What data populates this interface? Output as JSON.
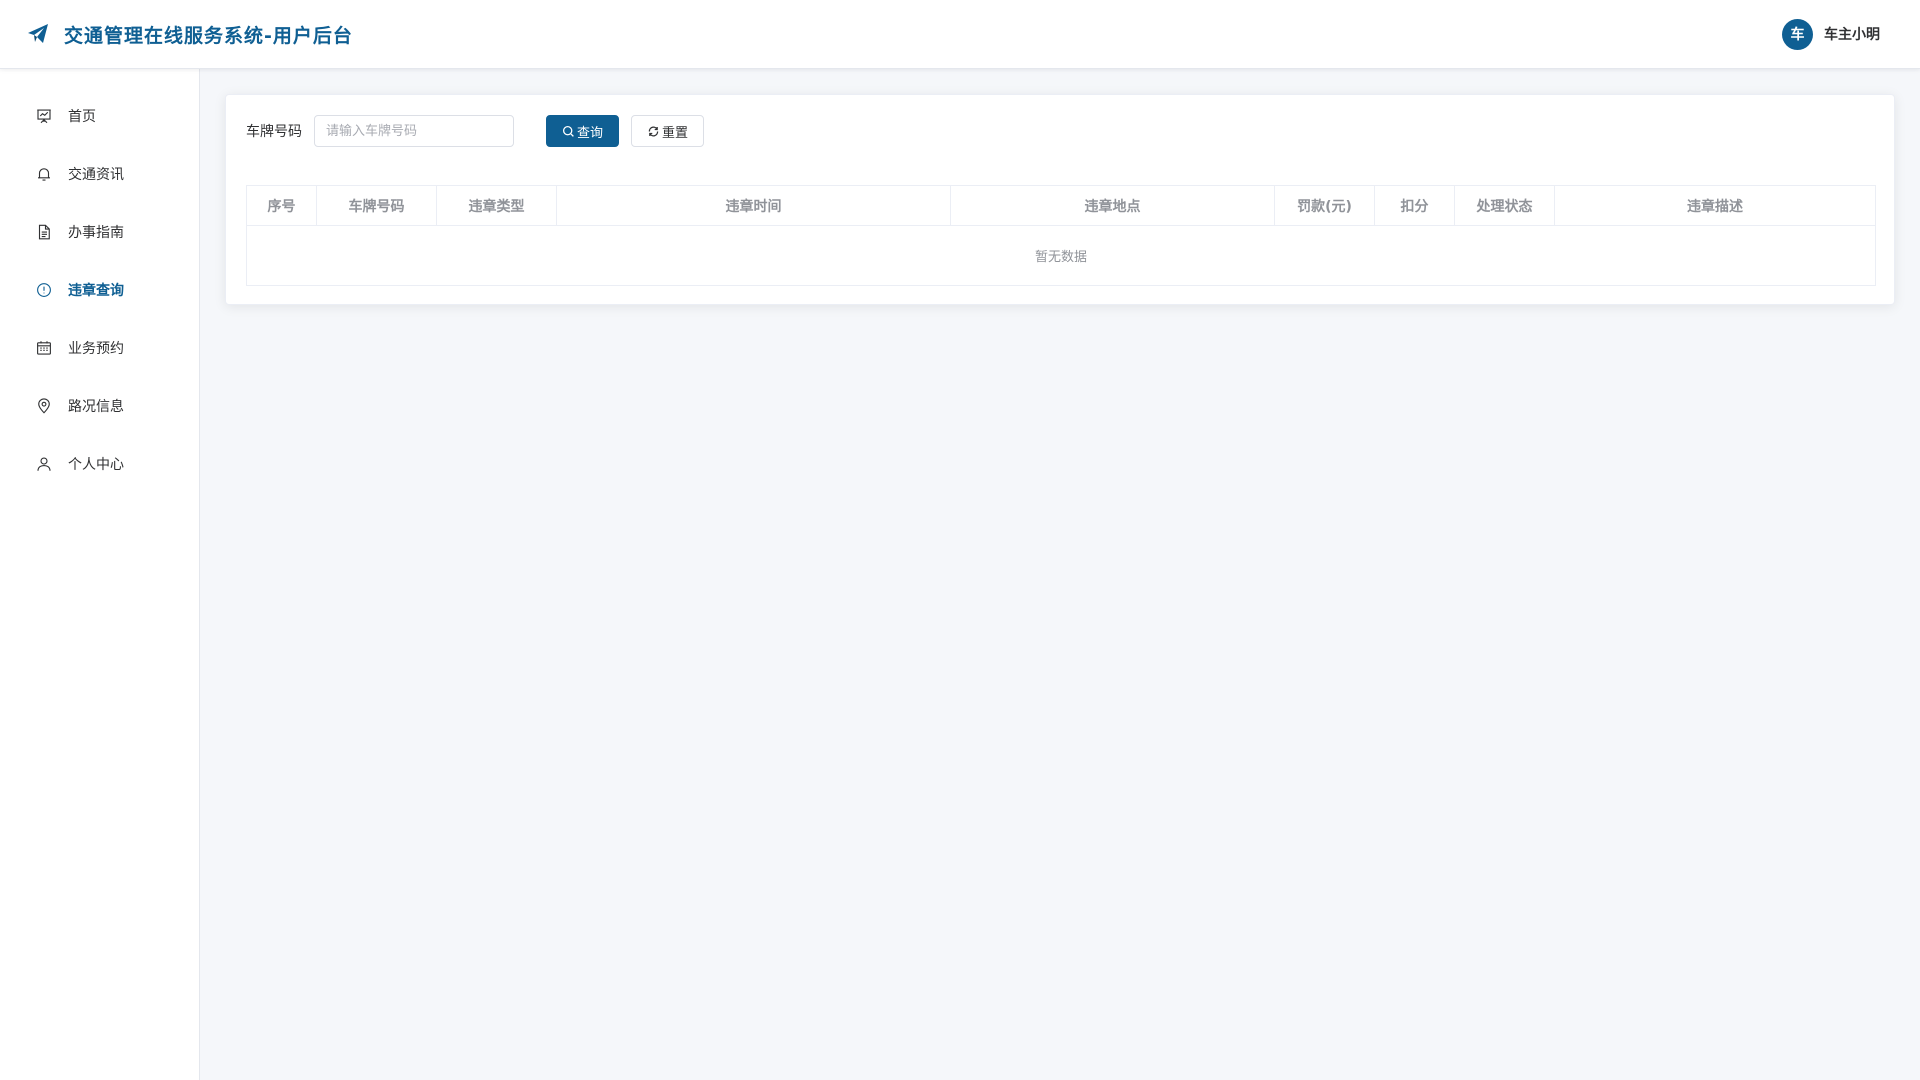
{
  "app": {
    "title": "交通管理在线服务系统-用户后台"
  },
  "user": {
    "avatar_text": "车",
    "name": "车主小明"
  },
  "sidebar": {
    "items": [
      {
        "label": "首页",
        "icon": "presentation-chart-icon",
        "active": false
      },
      {
        "label": "交通资讯",
        "icon": "bell-icon",
        "active": false
      },
      {
        "label": "办事指南",
        "icon": "document-icon",
        "active": false
      },
      {
        "label": "违章查询",
        "icon": "warning-circle-icon",
        "active": true
      },
      {
        "label": "业务预约",
        "icon": "calendar-icon",
        "active": false
      },
      {
        "label": "路况信息",
        "icon": "location-pin-icon",
        "active": false
      },
      {
        "label": "个人中心",
        "icon": "user-icon",
        "active": false
      }
    ]
  },
  "search": {
    "label": "车牌号码",
    "value": "",
    "placeholder": "请输入车牌号码",
    "query_label": "查询",
    "reset_label": "重置"
  },
  "table": {
    "columns": [
      "序号",
      "车牌号码",
      "违章类型",
      "违章时间",
      "违章地点",
      "罚款(元)",
      "扣分",
      "处理状态",
      "违章描述"
    ],
    "rows": [],
    "empty_text": "暂无数据"
  },
  "colors": {
    "primary": "#0f5f93",
    "background": "#f5f7fa"
  }
}
